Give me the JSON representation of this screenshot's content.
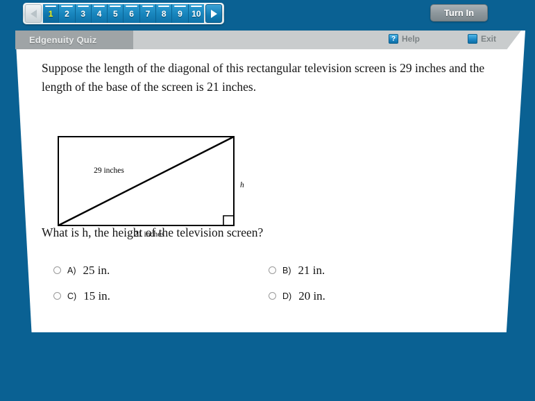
{
  "nav": {
    "prev_label": "◀",
    "next_label": "▶",
    "prev_icon": "triangle-left-icon",
    "next_icon": "triangle-right-icon",
    "active_index": 1,
    "pages": [
      "1",
      "2",
      "3",
      "4",
      "5",
      "6",
      "7",
      "8",
      "9",
      "10"
    ]
  },
  "toolbar": {
    "turn_in_label": "Turn In"
  },
  "panel": {
    "title": "Edgenuity Quiz",
    "help_label": "Help",
    "help_icon_glyph": "?",
    "exit_label": "Exit",
    "exit_icon_glyph": ""
  },
  "question": {
    "stem": "Suppose the length of the diagonal of this rectangular television screen is 29 inches and the length of the base of the screen is 21 inches.",
    "prompt": "What is h, the height of the television screen?",
    "figure": {
      "diagonal_label": "29 inches",
      "base_label": "21 inches",
      "height_label": "h",
      "right_angle_marker": true
    },
    "options": [
      {
        "letter": "A)",
        "text": "25 in.",
        "selected": false
      },
      {
        "letter": "B)",
        "text": "21 in.",
        "selected": false
      },
      {
        "letter": "C)",
        "text": "15 in.",
        "selected": false
      },
      {
        "letter": "D)",
        "text": "20 in.",
        "selected": false
      }
    ]
  },
  "colors": {
    "background": "#0a6193",
    "panel": "#ffffff",
    "nav_active_text": "#f2f21a",
    "nav_button": "#1784bc",
    "header_tab": "#9fa4a6",
    "header_bar": "#c9cccd"
  }
}
